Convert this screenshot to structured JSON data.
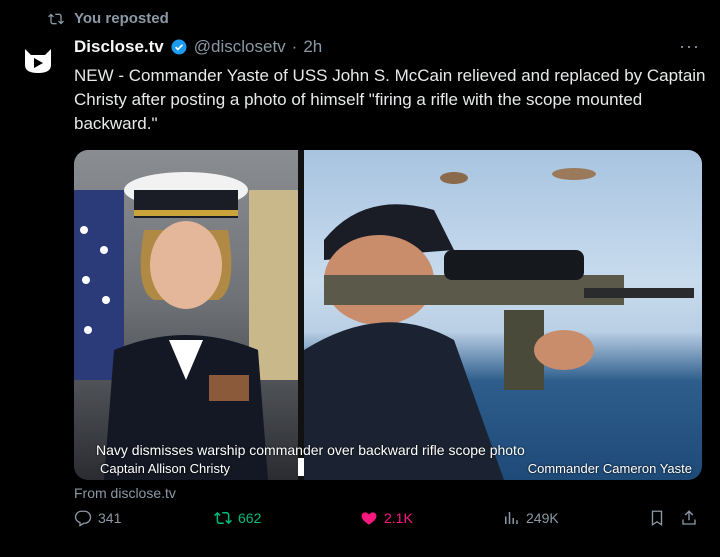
{
  "repost": {
    "label": "You reposted"
  },
  "post": {
    "author_name": "Disclose.tv",
    "handle": "@disclosetv",
    "separator": "·",
    "time": "2h",
    "more_label": "···",
    "text": "NEW - Commander Yaste of USS John S. McCain relieved and replaced by Captain Christy after posting a photo of himself \"firing a rifle with the scope mounted backward.\""
  },
  "media": {
    "caption_main": "Navy dismisses warship commander over backward rifle scope photo",
    "caption_left": "Captain Allison Christy",
    "caption_right": "Commander Cameron Yaste"
  },
  "source": {
    "label": "From disclose.tv"
  },
  "actions": {
    "replies": "341",
    "reposts": "662",
    "likes": "2.1K",
    "views": "249K"
  },
  "colors": {
    "background": "#000000",
    "verified": "#1d9bf0",
    "repost_active": "#00ba7c",
    "like_active": "#f91880",
    "muted": "#8b98a5"
  },
  "icons": [
    "repost-icon",
    "verified-badge-icon",
    "more-icon",
    "reply-icon",
    "like-icon",
    "views-icon",
    "bookmark-icon",
    "share-icon"
  ]
}
